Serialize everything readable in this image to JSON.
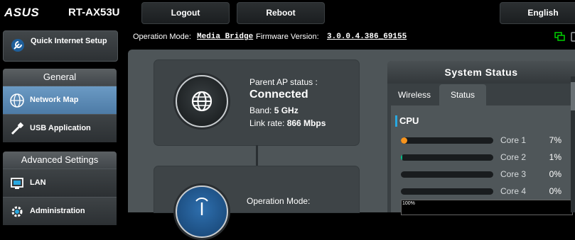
{
  "header": {
    "brand": "ASUS",
    "model": "RT-AX53U",
    "logout_label": "Logout",
    "reboot_label": "Reboot",
    "language_label": "English"
  },
  "info": {
    "op_mode_label": "Operation Mode:",
    "op_mode_value": "Media Bridge",
    "fw_label": "Firmware Version:",
    "fw_value": "3.0.0.4.386_69155"
  },
  "sidebar": {
    "quick_setup": "Quick Internet Setup",
    "general_header": "General",
    "advanced_header": "Advanced Settings",
    "general_items": [
      {
        "label": "Network Map",
        "icon": "network-map-icon"
      },
      {
        "label": "USB Application",
        "icon": "usb-icon"
      }
    ],
    "advanced_items": [
      {
        "label": "LAN",
        "icon": "lan-icon"
      },
      {
        "label": "Administration",
        "icon": "administration-icon"
      }
    ]
  },
  "parent_ap": {
    "title": "Parent AP status :",
    "state": "Connected",
    "band_label": "Band:",
    "band_value": "5 GHz",
    "rate_label": "Link rate:",
    "rate_value": "866 Mbps"
  },
  "operation_card": {
    "title": "Operation Mode:"
  },
  "system_status": {
    "title": "System Status",
    "tabs": [
      "Wireless",
      "Status"
    ],
    "active_tab": "Status",
    "cpu_title": "CPU",
    "cores": [
      {
        "name": "Core 1",
        "pct": "7%",
        "level": 0.07,
        "color": "#f7941d"
      },
      {
        "name": "Core 2",
        "pct": "1%",
        "level": 0.01,
        "color": "#00c48c"
      },
      {
        "name": "Core 3",
        "pct": "0%",
        "level": 0,
        "color": "#29a8e0"
      },
      {
        "name": "Core 4",
        "pct": "0%",
        "level": 0,
        "color": "#29a8e0"
      }
    ],
    "graph_label": "100%"
  },
  "colors": {
    "accent": "#29a8e0",
    "active_nav": "#5a88b3",
    "status_icon": "#00d000"
  }
}
